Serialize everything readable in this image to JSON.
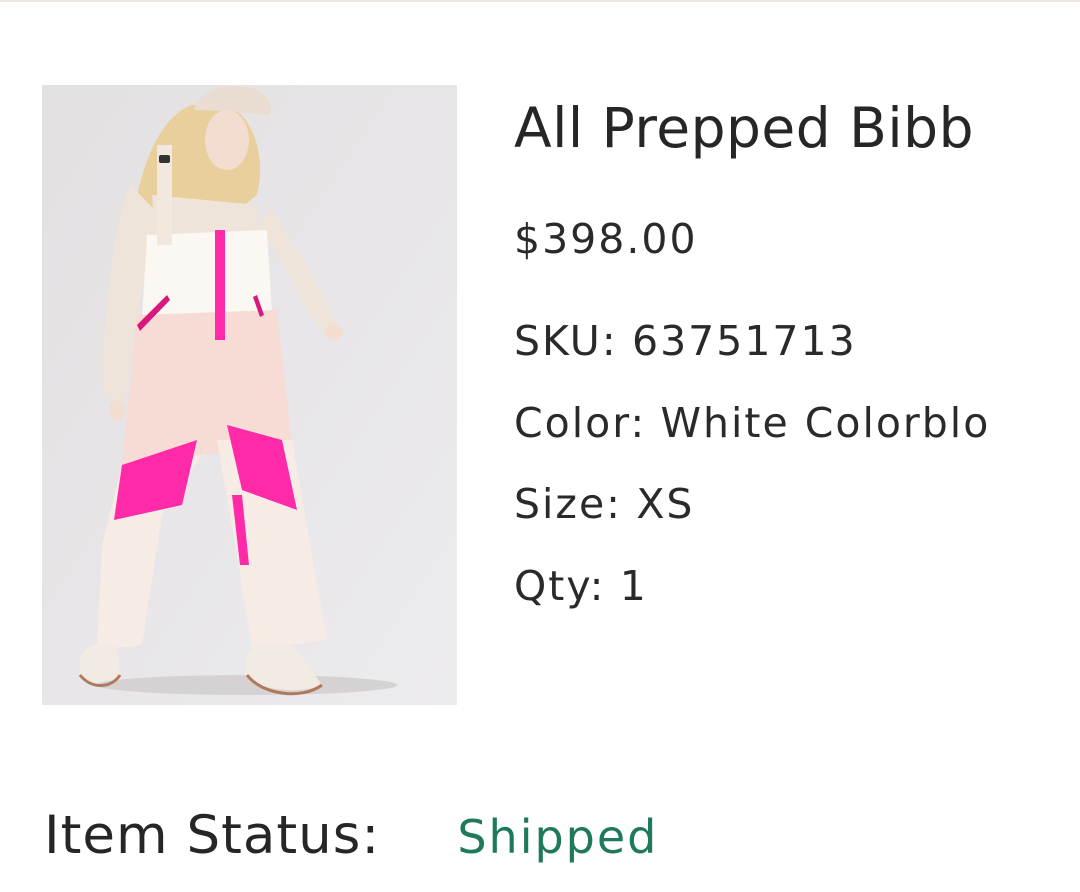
{
  "product": {
    "name": "All Prepped Bibb",
    "price": "$398.00",
    "image_alt": "model wearing white and pink ski bib overalls",
    "sku_label": "SKU:",
    "sku": "63751713",
    "color_label": "Color:",
    "color": "White Colorblo",
    "size_label": "Size:",
    "size": "XS",
    "qty_label": "Qty:",
    "qty": "1"
  },
  "status": {
    "label": "Item Status:",
    "value": "Shipped",
    "value_color": "#1f7a5a"
  },
  "colors": {
    "accent_pink": "#ff2aa8",
    "garment_white": "#f7f1ec",
    "background": "#ffffff"
  }
}
